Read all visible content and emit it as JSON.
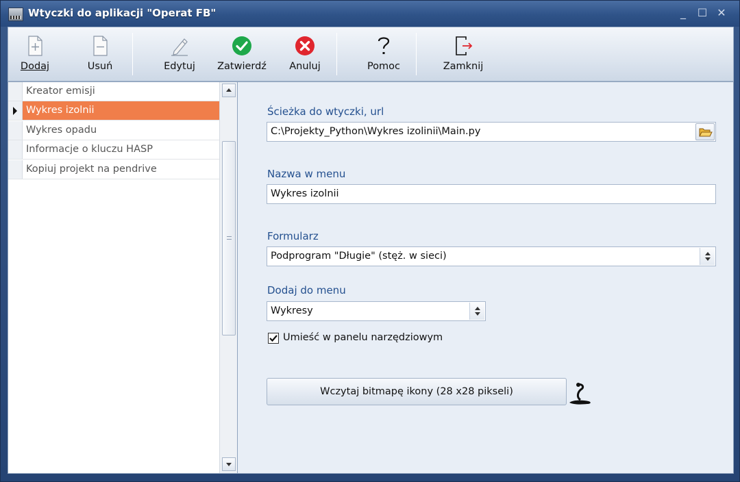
{
  "window": {
    "title": "Wtyczki do aplikacji \"Operat FB\"",
    "controls": {
      "minimize": "_",
      "maximize": "☐",
      "close": "✕"
    }
  },
  "toolbar": {
    "add": "Dodaj",
    "remove": "Usuń",
    "edit": "Edytuj",
    "confirm": "Zatwierdź",
    "cancel": "Anuluj",
    "help": "Pomoc",
    "close": "Zamknij"
  },
  "plugins": {
    "items": [
      {
        "label": "Kreator emisji"
      },
      {
        "label": "Wykres izolnii"
      },
      {
        "label": "Wykres opadu"
      },
      {
        "label": "Informacje o kluczu  HASP"
      },
      {
        "label": "Kopiuj projekt na pendrive"
      }
    ],
    "selected_index": 1
  },
  "form": {
    "path": {
      "label": "Ścieżka do wtyczki, url",
      "value": "C:\\Projekty_Python\\Wykres izolinii\\Main.py"
    },
    "menu_name": {
      "label": "Nazwa w menu",
      "value": "Wykres izolnii"
    },
    "form_type": {
      "label": "Formularz",
      "value": "Podprogram \"Długie\" (stęż.  w sieci)"
    },
    "add_to_menu": {
      "label": "Dodaj do menu",
      "value": "Wykresy"
    },
    "toolbar_checkbox": {
      "label": "Umieść w panelu narzędziowym",
      "checked": true
    },
    "load_icon_button": "Wczytaj bitmapę ikony  (28 x28 pikseli)"
  },
  "colors": {
    "selection": "#f07e4a",
    "label": "#24508f",
    "confirm_green": "#1ea84a",
    "cancel_red": "#e0262e"
  }
}
